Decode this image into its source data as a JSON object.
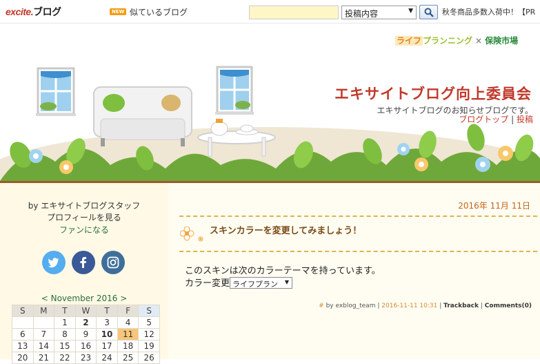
{
  "topbar": {
    "logo_excite": "excite.",
    "logo_blog": "ブログ",
    "new_badge": "NEW",
    "similar_blogs": "似ているブログ",
    "search_scope": "投稿内容",
    "promo": "秋冬商品多数入荷中！【PR"
  },
  "header": {
    "sponsor_a": "ライフ",
    "sponsor_b": "プランニング",
    "sponsor_x": "×",
    "sponsor_c": "保険市場",
    "title": "エキサイトブログ向上委員会",
    "subtitle": "エキサイトブログのお知らせブログです。",
    "link_top": "ブログトップ",
    "link_sep": "|",
    "link_post": "投稿"
  },
  "sidebar": {
    "by": "by エキサイトブログスタッフ",
    "profile": "プロフィールを見る",
    "fan": "ファンになる",
    "calendar_title": "< November 2016 >",
    "calendar_header": [
      "S",
      "M",
      "T",
      "W",
      "T",
      "F",
      "S"
    ],
    "calendar_rows": [
      [
        "",
        "",
        "1",
        "2",
        "3",
        "4",
        "5"
      ],
      [
        "6",
        "7",
        "8",
        "9",
        "10",
        "11",
        "12"
      ],
      [
        "13",
        "14",
        "15",
        "16",
        "17",
        "18",
        "19"
      ],
      [
        "20",
        "21",
        "22",
        "23",
        "24",
        "25",
        "26"
      ]
    ]
  },
  "post": {
    "date": "2016年 11月 11日",
    "title": "スキンカラーを変更してみましょう！",
    "body_line1": "このスキンは次のカラーテーマを持っています。",
    "color_label": "カラー変更",
    "color_value": "ライフプラン",
    "footer_hash": "#",
    "footer_by": "by exblog_team",
    "footer_sep": "|",
    "footer_time": "2016-11-11 10:31",
    "footer_trackback": "Trackback",
    "footer_comments": "Comments(0)"
  },
  "colors": {
    "title_red": "#c0392b",
    "accent_orange": "#e0b24a",
    "sidebar_bg": "#fff9e6"
  }
}
